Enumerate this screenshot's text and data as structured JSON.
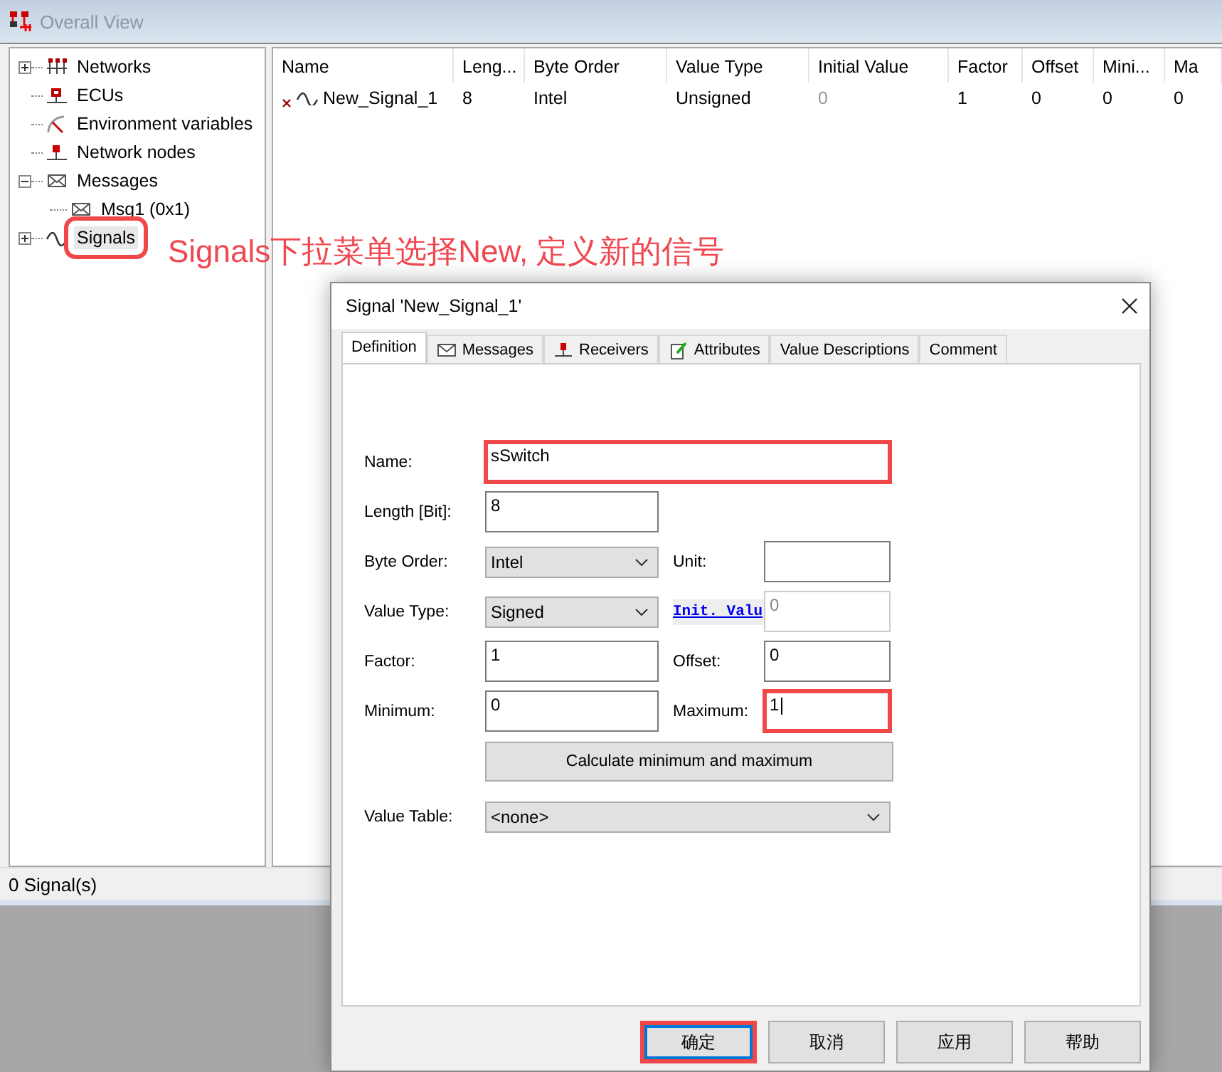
{
  "window": {
    "title": "Overall View"
  },
  "tree": [
    {
      "label": "Networks",
      "kind": "network",
      "expanded": false,
      "selected": false,
      "highlighted": false
    },
    {
      "label": "ECUs",
      "kind": "ecu",
      "selected": false,
      "highlighted": false
    },
    {
      "label": "Environment variables",
      "kind": "gauge",
      "selected": false,
      "highlighted": false
    },
    {
      "label": "Network nodes",
      "kind": "node",
      "selected": false,
      "highlighted": false
    },
    {
      "label": "Messages",
      "kind": "message",
      "expanded": true,
      "selected": false,
      "highlighted": false,
      "children": [
        {
          "label": "Msg1 (0x1)",
          "kind": "message",
          "selected": false,
          "highlighted": false
        }
      ]
    },
    {
      "label": "Signals",
      "kind": "signal",
      "expanded": false,
      "selected": true,
      "highlighted": true
    }
  ],
  "table": {
    "columns": [
      "Name",
      "Leng...",
      "Byte Order",
      "Value Type",
      "Initial Value",
      "Factor",
      "Offset",
      "Mini...",
      "Ma"
    ],
    "rows": [
      {
        "cells": [
          "New_Signal_1",
          "8",
          "Intel",
          "Unsigned",
          "0",
          "1",
          "0",
          "0",
          "0"
        ],
        "initial_value_inactive": true
      }
    ]
  },
  "status_bar": "0 Signal(s)",
  "annotation": "Signals下拉菜单选择New, 定义新的信号",
  "dialog": {
    "title": "Signal 'New_Signal_1'",
    "tabs": [
      {
        "label": "Definition",
        "kind": "plain",
        "selected": true
      },
      {
        "label": "Messages",
        "kind": "message",
        "selected": false
      },
      {
        "label": "Receivers",
        "kind": "node",
        "selected": false
      },
      {
        "label": "Attributes",
        "kind": "pencil",
        "selected": false
      },
      {
        "label": "Value Descriptions",
        "kind": "plain",
        "selected": false
      },
      {
        "label": "Comment",
        "kind": "plain",
        "selected": false
      }
    ],
    "rows": [
      {
        "left": {
          "label": "Name:",
          "kind": "text",
          "value": "sSwitch",
          "highlighted": true,
          "focused": false
        }
      },
      {
        "left": {
          "label": "Length [Bit]:",
          "kind": "text",
          "value": "8",
          "highlighted": false,
          "focused": false
        }
      },
      {
        "left": {
          "label": "Byte Order:",
          "kind": "select",
          "value": "Intel",
          "highlighted": false,
          "focused": false
        },
        "right": {
          "label": "Unit:",
          "kind": "text",
          "link": false,
          "highlighted": false,
          "focused": false
        }
      },
      {
        "left": {
          "label": "Value Type:",
          "kind": "select",
          "value": "Signed",
          "highlighted": false,
          "focused": false
        },
        "right": {
          "label": "Init. Valu",
          "kind": "disabled",
          "value": "0",
          "link": true,
          "highlighted": false,
          "focused": false
        }
      },
      {
        "left": {
          "label": "Factor:",
          "kind": "text",
          "value": "1",
          "highlighted": false,
          "focused": false
        },
        "right": {
          "label": "Offset:",
          "kind": "text",
          "value": "0",
          "link": false,
          "highlighted": false,
          "focused": false
        }
      },
      {
        "left": {
          "label": "Minimum:",
          "kind": "text",
          "value": "0",
          "highlighted": false,
          "focused": false
        },
        "right": {
          "label": "Maximum:",
          "kind": "text",
          "value": "1",
          "link": false,
          "highlighted": true,
          "focused": true
        }
      }
    ],
    "calc_button": "Calculate minimum and maximum",
    "value_table": {
      "label": "Value Table:",
      "value": "<none>"
    },
    "buttons": [
      {
        "label": "确定",
        "default": true,
        "highlighted": true
      },
      {
        "label": "取消",
        "default": false,
        "highlighted": false
      },
      {
        "label": "应用",
        "default": false,
        "highlighted": false
      },
      {
        "label": "帮助",
        "default": false,
        "highlighted": false
      }
    ]
  }
}
